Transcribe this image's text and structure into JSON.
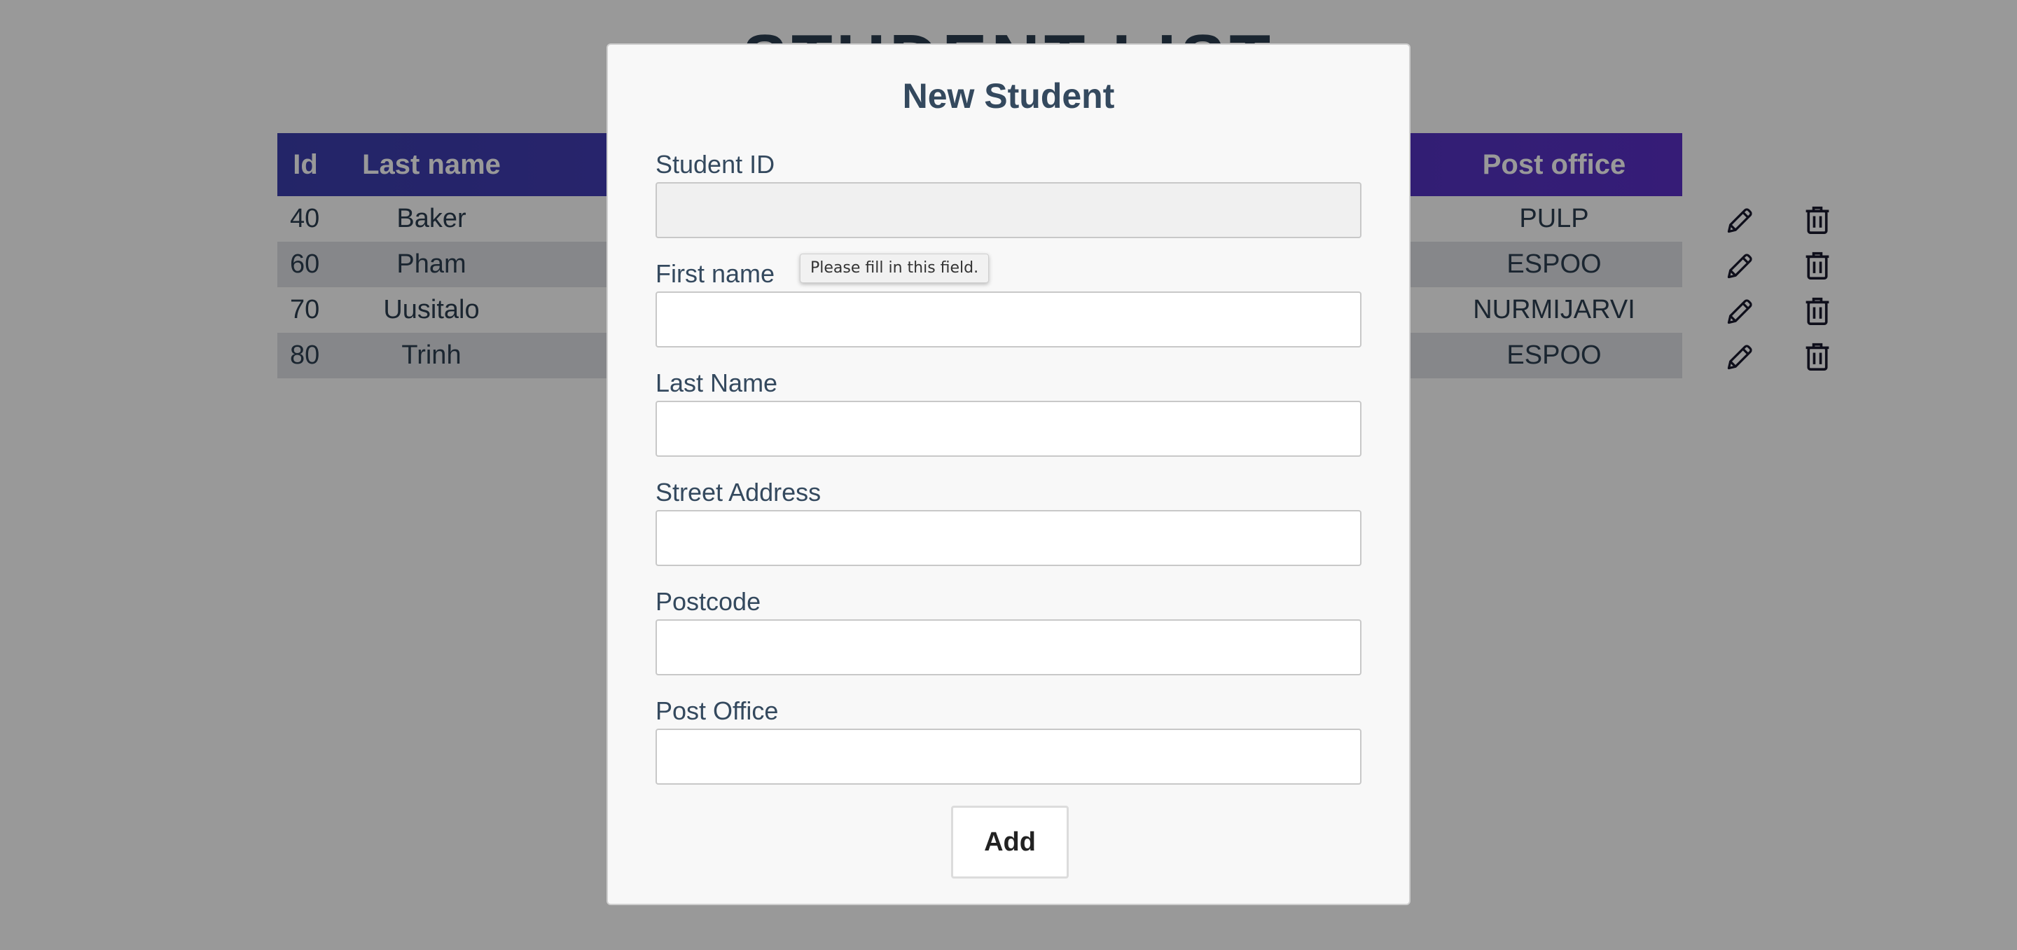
{
  "page": {
    "title": "STUDENT LIST"
  },
  "table": {
    "headers": [
      "Id",
      "Last name",
      "Post office"
    ],
    "rows": [
      {
        "id": "40",
        "last_name": "Baker",
        "post_office": "PULP"
      },
      {
        "id": "60",
        "last_name": "Pham",
        "post_office": "ESPOO"
      },
      {
        "id": "70",
        "last_name": "Uusitalo",
        "post_office": "NURMIJARVI"
      },
      {
        "id": "80",
        "last_name": "Trinh",
        "post_office": "ESPOO"
      }
    ],
    "actions": {
      "edit_icon": "pencil-icon",
      "delete_icon": "trash-icon"
    }
  },
  "modal": {
    "title": "New Student",
    "fields": [
      {
        "label": "Student ID",
        "value": "",
        "disabled": true
      },
      {
        "label": "First name",
        "value": ""
      },
      {
        "label": "Last Name",
        "value": ""
      },
      {
        "label": "Street Address",
        "value": ""
      },
      {
        "label": "Postcode",
        "value": ""
      },
      {
        "label": "Post Office",
        "value": ""
      }
    ],
    "validation_tooltip": "Please fill in this field.",
    "submit_label": "Add"
  },
  "colors": {
    "header_gradient_start": "#3b3fae",
    "header_gradient_end": "#5a30c7",
    "text": "#2c3e50",
    "overlay": "rgba(0,0,0,0.4)"
  }
}
